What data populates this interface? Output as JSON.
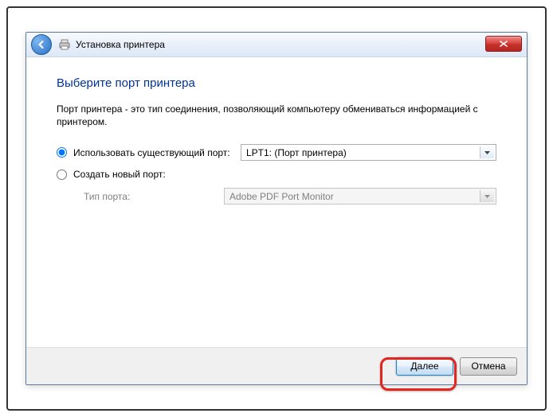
{
  "titlebar": {
    "title": "Установка принтера"
  },
  "content": {
    "heading": "Выберите порт принтера",
    "description": "Порт принтера - это тип соединения, позволяющий компьютеру обмениваться информацией с принтером.",
    "option_existing_label": "Использовать существующий порт:",
    "option_existing_value": "LPT1: (Порт принтера)",
    "option_create_label": "Создать новый порт:",
    "port_type_label": "Тип порта:",
    "port_type_value": "Adobe PDF Port Monitor"
  },
  "footer": {
    "next": "Далее",
    "cancel": "Отмена"
  }
}
